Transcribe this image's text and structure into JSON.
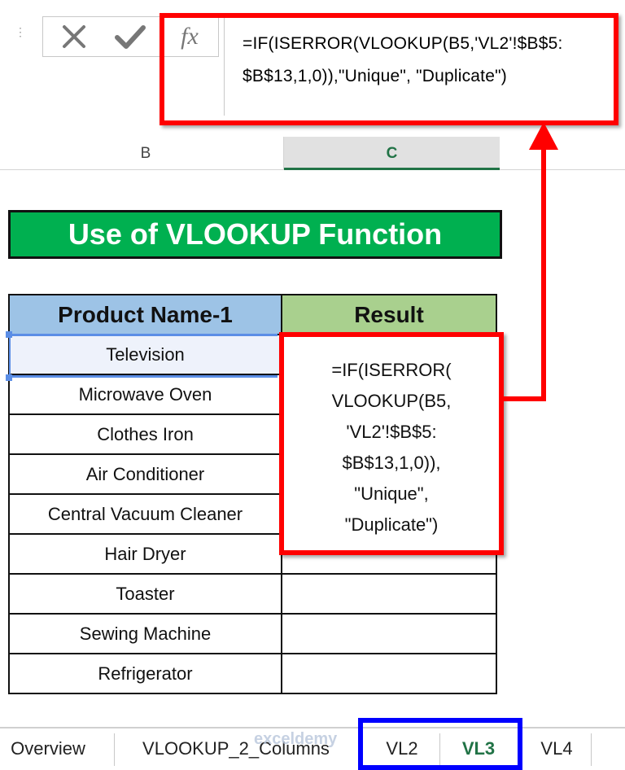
{
  "formula_bar": {
    "cancel_icon": "x-icon",
    "enter_icon": "check-icon",
    "fx_label": "fx",
    "formula_line1": "=IF(ISERROR(VLOOKUP(B5,'VL2'!$B$5:",
    "formula_line2": "$B$13,1,0)),\"Unique\", \"Duplicate\")"
  },
  "column_headers": [
    {
      "label": "B"
    },
    {
      "label": "C"
    }
  ],
  "title": "Use of VLOOKUP Function",
  "table": {
    "headers": [
      "Product Name-1",
      "Result"
    ],
    "header_colors": [
      "#9dc3e6",
      "#a9d08e"
    ],
    "rows": [
      {
        "product": "Television",
        "result": ""
      },
      {
        "product": "Microwave Oven",
        "result": ""
      },
      {
        "product": "Clothes Iron",
        "result": ""
      },
      {
        "product": "Air Conditioner",
        "result": ""
      },
      {
        "product": "Central Vacuum Cleaner",
        "result": ""
      },
      {
        "product": "Hair Dryer",
        "result": ""
      },
      {
        "product": "Toaster",
        "result": ""
      },
      {
        "product": "Sewing Machine",
        "result": ""
      },
      {
        "product": "Refrigerator",
        "result": ""
      }
    ]
  },
  "cell_edit": {
    "lines": [
      "=IF(ISERROR(",
      "VLOOKUP(B5,",
      "'VL2'!$B$5:",
      "$B$13,1,0)),",
      "\"Unique\",",
      "\"Duplicate\")"
    ]
  },
  "sheet_tabs": [
    {
      "label": "Overview",
      "active": false
    },
    {
      "label": "VLOOKUP_2_Columns",
      "active": false
    },
    {
      "label": "VL2",
      "active": false
    },
    {
      "label": "VL3",
      "active": true
    },
    {
      "label": "VL4",
      "active": false
    }
  ],
  "watermark": "exceldemy",
  "colors": {
    "highlight_red": "#ff0000",
    "highlight_blue": "#0000ff",
    "title_green": "#00b050",
    "active_tab_green": "#217346"
  }
}
